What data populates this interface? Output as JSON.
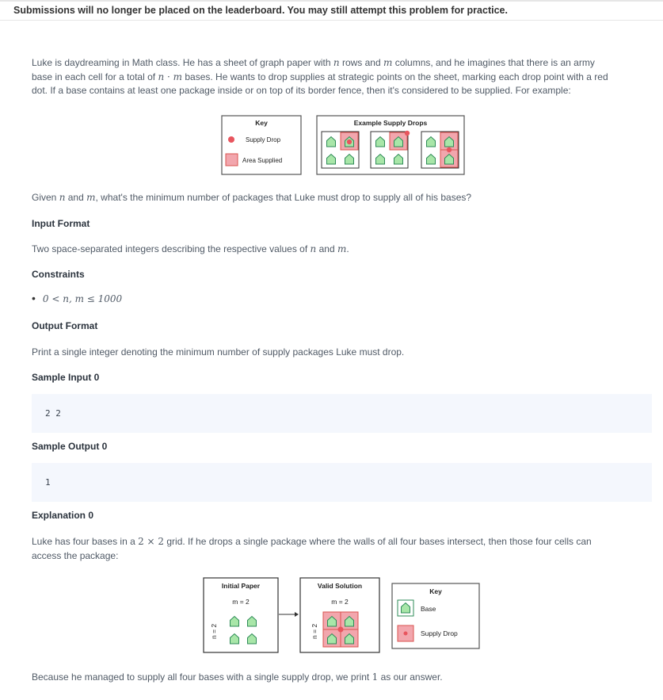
{
  "banner": {
    "text": "Submissions will no longer be placed on the leaderboard. You may still attempt this problem for practice."
  },
  "intro": {
    "l1a": "Luke is daydreaming in Math class. He has a sheet of graph paper with ",
    "n": "n",
    "l1b": " rows and ",
    "m": "m",
    "l1c": " columns, and he imagines that there is an army",
    "l2a": "base in each cell for a total of ",
    "l2n": "n",
    "l2dot": " · ",
    "l2m": "m",
    "l2b": " bases. He wants to drop supplies at strategic points on the sheet, marking each drop point with a red",
    "l3": "dot. If a base contains at least one package inside or on top of its border fence, then it's considered to be supplied. For example:"
  },
  "figure1": {
    "key_title": "Key",
    "key_supply_drop": "Supply Drop",
    "key_area_supplied": "Area Supplied",
    "example_title": "Example Supply Drops",
    "colors": {
      "base_fill": "#a8e6a8",
      "base_border": "#2e8b57",
      "supplied_fill": "#f2a6ad",
      "supplied_border": "#d9534f",
      "drop": "#e8555e"
    }
  },
  "question": {
    "a": "Given ",
    "n": "n",
    "b": " and ",
    "m": "m",
    "c": ", what's the minimum number of packages that Luke must drop to supply all of his bases?"
  },
  "input_format": {
    "heading": "Input Format",
    "text_a": "Two space-separated integers describing the respective values of ",
    "n": "n",
    "and": " and ",
    "m": "m",
    "end": "."
  },
  "constraints": {
    "heading": "Constraints",
    "item": "0 < n, m ≤ 1000"
  },
  "output_format": {
    "heading": "Output Format",
    "text": "Print a single integer denoting the minimum number of supply packages Luke must drop."
  },
  "sample_input": {
    "heading": "Sample Input 0",
    "code": "2 2"
  },
  "sample_output": {
    "heading": "Sample Output 0",
    "code": "1"
  },
  "explanation": {
    "heading": "Explanation 0",
    "l1a": "Luke has four bases in a ",
    "grid": "2 × 2",
    "l1b": " grid. If he drops a single package where the walls of all four bases intersect, then those four cells can",
    "l2": "access the package:"
  },
  "figure2": {
    "initial_title": "Initial Paper",
    "valid_title": "Valid Solution",
    "m_label": "m = 2",
    "n_label": "n = 2",
    "key_title": "Key",
    "key_base": "Base",
    "key_supply_drop": "Supply Drop"
  },
  "conclusion": {
    "a": "Because he managed to supply all four bases with a single supply drop, we print ",
    "num": "1",
    "b": " as our answer."
  }
}
